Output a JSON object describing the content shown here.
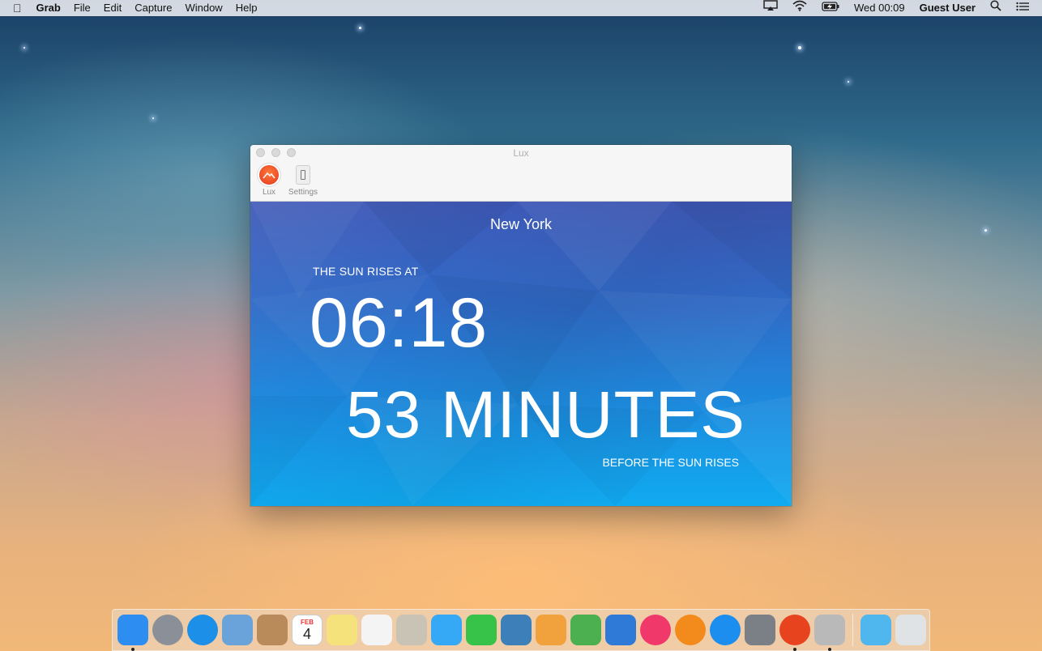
{
  "menubar": {
    "app": "Grab",
    "menus": [
      "File",
      "Edit",
      "Capture",
      "Window",
      "Help"
    ],
    "clock": "Wed 00:09",
    "user": "Guest User"
  },
  "window": {
    "title": "Lux",
    "toolbar": {
      "lux_label": "Lux",
      "settings_label": "Settings"
    },
    "city": "New York",
    "rise_label": "THE SUN RISES AT",
    "rise_time": "06:18",
    "countdown": "53 MINUTES",
    "countdown_label": "BEFORE THE SUN RISES"
  },
  "dock": {
    "apps": [
      {
        "name": "finder-icon",
        "color": "#2d8df0"
      },
      {
        "name": "launchpad-icon",
        "color": "#8a8f98"
      },
      {
        "name": "safari-icon",
        "color": "#1c8fe8"
      },
      {
        "name": "mail-icon",
        "color": "#6aa3d9"
      },
      {
        "name": "contacts-icon",
        "color": "#b98a5a"
      },
      {
        "name": "calendar-icon",
        "color": "#ffffff"
      },
      {
        "name": "notes-icon",
        "color": "#f6e27a"
      },
      {
        "name": "reminders-icon",
        "color": "#f4f4f4"
      },
      {
        "name": "photo-booth-icon",
        "color": "#c9c3b5"
      },
      {
        "name": "messages-icon",
        "color": "#35a9f5"
      },
      {
        "name": "facetime-icon",
        "color": "#37c24a"
      },
      {
        "name": "iphoto-icon",
        "color": "#3d7fb8"
      },
      {
        "name": "pages-icon",
        "color": "#f1a23c"
      },
      {
        "name": "numbers-icon",
        "color": "#4caf50"
      },
      {
        "name": "keynote-icon",
        "color": "#2f7ad6"
      },
      {
        "name": "itunes-icon",
        "color": "#f0386b"
      },
      {
        "name": "ibooks-icon",
        "color": "#f28b1c"
      },
      {
        "name": "app-store-icon",
        "color": "#1b8ef0"
      },
      {
        "name": "system-preferences-icon",
        "color": "#7b7f86"
      },
      {
        "name": "lux-app-icon",
        "color": "#e8431f"
      },
      {
        "name": "grab-icon",
        "color": "#b9b9b9"
      }
    ],
    "calendar_month": "FEB",
    "calendar_day": "4",
    "extras": [
      {
        "name": "downloads-folder-icon",
        "color": "#4fb7ee"
      },
      {
        "name": "trash-icon",
        "color": "#dfe3e6"
      }
    ]
  }
}
